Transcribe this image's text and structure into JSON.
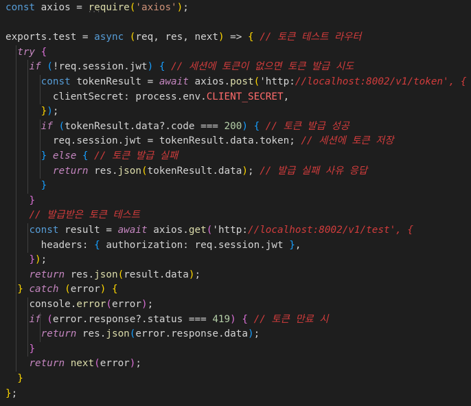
{
  "editor": {
    "lines": [
      "const axios = require('axios');",
      "",
      "exports.test = async (req, res, next) => { // 토큰 테스트 라우터",
      "  try {",
      "    if (!req.session.jwt) { // 세션에 토큰이 없으면 토큰 발급 시도",
      "      const tokenResult = await axios.post('http://localhost:8002/v1/token', {",
      "        clientSecret: process.env.CLIENT_SECRET,",
      "      });",
      "      if (tokenResult.data?.code === 200) { // 토큰 발급 성공",
      "        req.session.jwt = tokenResult.data.token; // 세션에 토큰 저장",
      "      } else { // 토큰 발급 실패",
      "        return res.json(tokenResult.data); // 발급 실패 사유 응답",
      "      }",
      "    }",
      "    // 발급받은 토큰 테스트",
      "    const result = await axios.get('http://localhost:8002/v1/test', {",
      "      headers: { authorization: req.session.jwt },",
      "    });",
      "    return res.json(result.data);",
      "  } catch (error) {",
      "    console.error(error);",
      "    if (error.response?.status === 419) { // 토큰 만료 시",
      "      return res.json(error.response.data);",
      "    }",
      "    return next(error);",
      "  }",
      "};"
    ]
  },
  "colors": {
    "background": "#1e1e1e",
    "keyword": "#569cd6",
    "control": "#c586c0",
    "function": "#dcdcaa",
    "string": "#ce9178",
    "number": "#b5cea8",
    "comment": "#d13c3c"
  }
}
